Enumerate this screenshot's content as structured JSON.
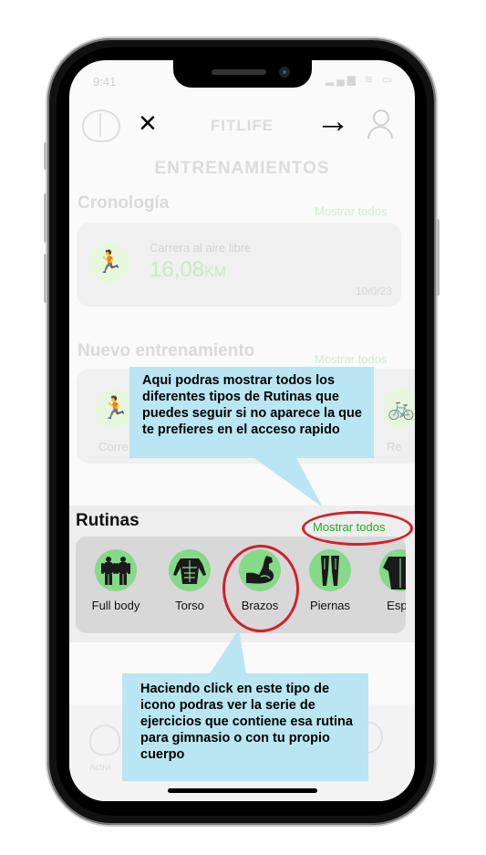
{
  "status_bar": {
    "time": "9:41",
    "icons": "▂▄▆ ≋ ▭"
  },
  "header": {
    "logo_icon": "brain-icon",
    "close_icon": "×",
    "title": "FITLIFE",
    "arrow_icon": "→",
    "profile_icon": "user-icon"
  },
  "page_heading": "ENTRENAMIENTOS",
  "cronologia": {
    "title": "Cronología",
    "show_all": "Mostrar todos",
    "entry": {
      "icon": "🏃",
      "activity": "Carrera al aire libre",
      "distance_value": "16,08",
      "distance_unit": "KM",
      "date": "10/0/23"
    }
  },
  "nuevo_entrenamiento": {
    "title": "Nuevo entrenamiento",
    "show_all": "Mostrar todos",
    "items": [
      {
        "label": "Corre",
        "icon": "🏃"
      },
      {
        "label": "Re",
        "icon": "🚲"
      }
    ]
  },
  "rutinas": {
    "title": "Rutinas",
    "show_all": "Mostrar todos",
    "items": [
      {
        "label": "Full body",
        "icon": "full-body-icon"
      },
      {
        "label": "Torso",
        "icon": "torso-icon"
      },
      {
        "label": "Brazos",
        "icon": "arm-muscle-icon"
      },
      {
        "label": "Piernas",
        "icon": "legs-icon"
      },
      {
        "label": "Espa",
        "icon": "back-icon"
      }
    ]
  },
  "bottom_nav": {
    "left_label": "Activi",
    "right_label": "ta"
  },
  "callouts": {
    "top": "Aqui podras mostrar todos los diferentes tipos de Rutinas que puedes seguir si no aparece la que te prefieres en el acceso rapido",
    "bottom": "Haciendo click en este tipo de icono podras ver la serie de ejercicios que contiene esa rutina para gimnasio o con tu propio cuerpo"
  },
  "colors": {
    "accent_green": "#1fae1f",
    "callout_bg": "#b9e6f2",
    "highlight_red": "#d2202a",
    "icon_green": "#86d988"
  }
}
